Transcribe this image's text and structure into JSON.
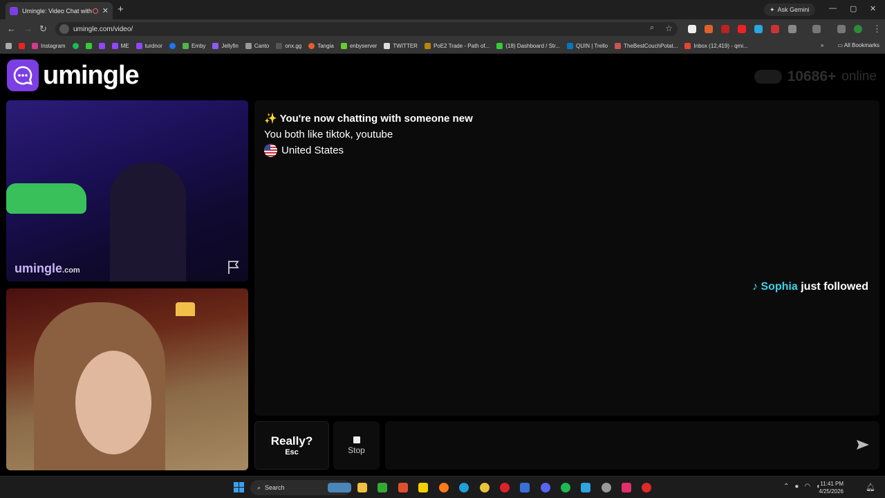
{
  "browser": {
    "tab_title": "Umingle: Video Chat with S",
    "tab_close": "✕",
    "new_tab": "+",
    "ask_gemini": "Ask Gemini",
    "url": "umingle.com/video/",
    "window_min": "—",
    "window_max": "▢",
    "window_close": "✕",
    "bookmarks": [
      "Instagram",
      "ME",
      "turdnor",
      "Emby",
      "Jellyfin",
      "Canto",
      "onx.gg",
      "Tangia",
      "enbyserver",
      "TWITTER",
      "PoE2 Trade - Path of...",
      "(18) Dashboard / Str...",
      "QUIN | Trello",
      "TheBestCouchPotat...",
      "Inbox (12,419) - qmi..."
    ],
    "all_bookmarks": "All Bookmarks"
  },
  "header": {
    "logo_text": "umingle",
    "online_count": "10686+",
    "online_label": "online"
  },
  "remote_video": {
    "watermark": "umingle",
    "watermark_suffix": ".com"
  },
  "chat": {
    "status_emoji": "✨",
    "status": "You're now chatting with someone new",
    "interests": "You both like tiktok, youtube",
    "country": "United States",
    "follow_icon": "♪",
    "follow_name": "Sophia",
    "follow_text": "just followed"
  },
  "controls": {
    "really_label": "Really?",
    "really_key": "Esc",
    "stop_label": "Stop",
    "message_placeholder": ""
  },
  "taskbar": {
    "search": "Search",
    "time": "11:41 PM",
    "date": "4/25/2026"
  },
  "colors": {
    "brand": "#7b3fe4",
    "follow_name": "#3fd2e6"
  }
}
